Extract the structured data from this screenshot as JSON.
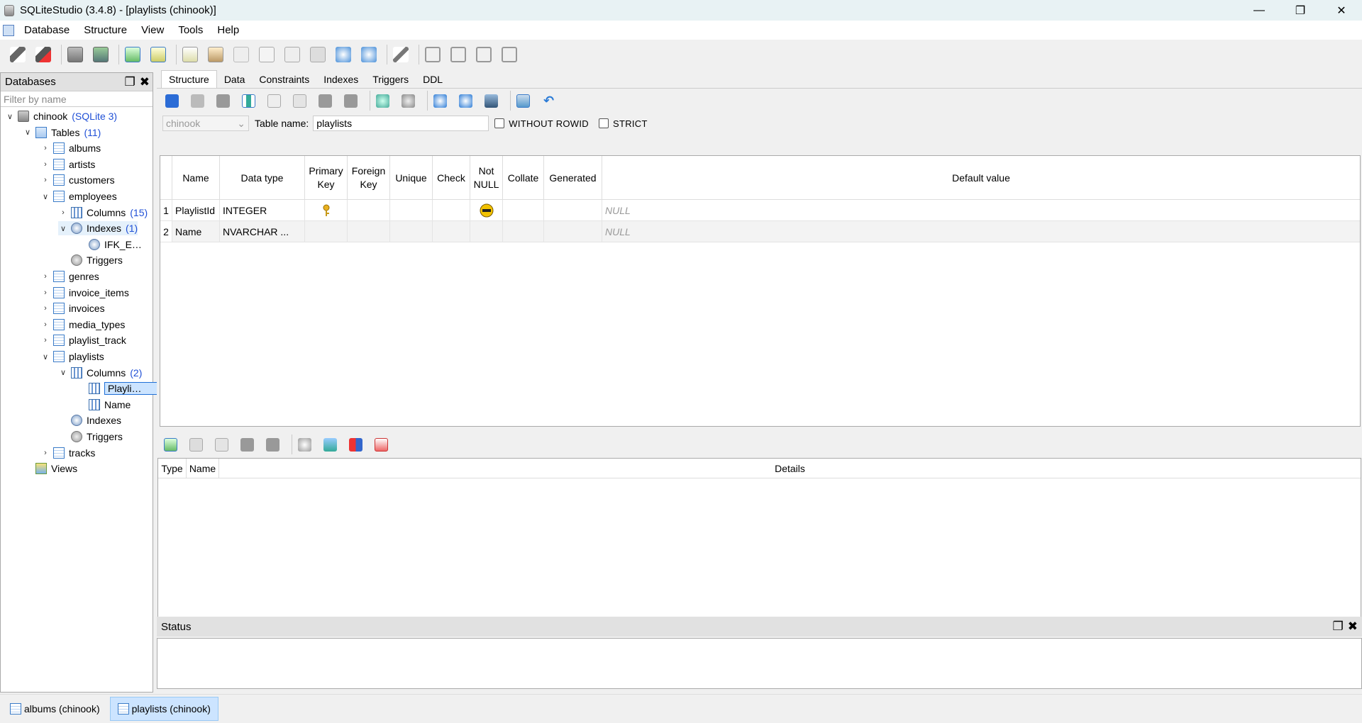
{
  "window": {
    "title": "SQLiteStudio (3.4.8) - [playlists (chinook)]"
  },
  "menu": [
    "Database",
    "Structure",
    "View",
    "Tools",
    "Help"
  ],
  "db_panel": {
    "title": "Databases",
    "filter_placeholder": "Filter by name",
    "tree": [
      {
        "label": "chinook",
        "extra": "(SQLite 3)",
        "level": 0,
        "icon": "database-icon",
        "chev": "v"
      },
      {
        "label": "Tables",
        "extra": "(11)",
        "level": 1,
        "icon": "tables-folder-icon",
        "chev": "v"
      },
      {
        "label": "albums",
        "level": 2,
        "icon": "table-icon",
        "chev": ">"
      },
      {
        "label": "artists",
        "level": 2,
        "icon": "table-icon",
        "chev": ">"
      },
      {
        "label": "customers",
        "level": 2,
        "icon": "table-icon",
        "chev": ">"
      },
      {
        "label": "employees",
        "level": 2,
        "icon": "table-icon",
        "chev": "v"
      },
      {
        "label": "Columns",
        "extra": "(15)",
        "level": 3,
        "icon": "columns-icon",
        "chev": ">"
      },
      {
        "label": "Indexes",
        "extra": "(1)",
        "level": 3,
        "icon": "index-icon",
        "chev": "v",
        "hover": true
      },
      {
        "label": "IFK_E…",
        "level": 4,
        "icon": "index-item-icon",
        "chev": ""
      },
      {
        "label": "Triggers",
        "level": 3,
        "icon": "trigger-icon",
        "chev": ""
      },
      {
        "label": "genres",
        "level": 2,
        "icon": "table-icon",
        "chev": ">"
      },
      {
        "label": "invoice_items",
        "level": 2,
        "icon": "table-icon",
        "chev": ">"
      },
      {
        "label": "invoices",
        "level": 2,
        "icon": "table-icon",
        "chev": ">"
      },
      {
        "label": "media_types",
        "level": 2,
        "icon": "table-icon",
        "chev": ">"
      },
      {
        "label": "playlist_track",
        "level": 2,
        "icon": "table-icon",
        "chev": ">"
      },
      {
        "label": "playlists",
        "level": 2,
        "icon": "table-icon",
        "chev": "v"
      },
      {
        "label": "Columns",
        "extra": "(2)",
        "level": 3,
        "icon": "columns-icon",
        "chev": "v"
      },
      {
        "label": "Playli…",
        "level": 4,
        "icon": "column-icon",
        "chev": "",
        "selected": true
      },
      {
        "label": "Name",
        "level": 4,
        "icon": "column-icon",
        "chev": ""
      },
      {
        "label": "Indexes",
        "level": 3,
        "icon": "index-icon",
        "chev": ""
      },
      {
        "label": "Triggers",
        "level": 3,
        "icon": "trigger-icon",
        "chev": ""
      },
      {
        "label": "tracks",
        "level": 2,
        "icon": "table-icon",
        "chev": ">"
      },
      {
        "label": "Views",
        "level": 1,
        "icon": "views-icon",
        "chev": ""
      }
    ]
  },
  "tabs": [
    "Structure",
    "Data",
    "Constraints",
    "Indexes",
    "Triggers",
    "DDL"
  ],
  "active_tab": "Structure",
  "structure": {
    "database_combo": "chinook",
    "table_name_label": "Table name:",
    "table_name": "playlists",
    "without_rowid_label": "WITHOUT ROWID",
    "strict_label": "STRICT",
    "columns_header": [
      "Name",
      "Data type",
      "Primary Key",
      "Foreign Key",
      "Unique",
      "Check",
      "Not NULL",
      "Collate",
      "Generated",
      "Default value"
    ],
    "rows": [
      {
        "num": "1",
        "name": "PlaylistId",
        "type": "INTEGER",
        "pk": true,
        "notnull": true,
        "default": "NULL"
      },
      {
        "num": "2",
        "name": "Name",
        "type": "NVARCHAR ...",
        "pk": false,
        "notnull": false,
        "default": "NULL"
      }
    ],
    "constraints_header": [
      "Type",
      "Name",
      "Details"
    ]
  },
  "status_panel": {
    "title": "Status"
  },
  "taskbar": [
    {
      "label": "albums (chinook)",
      "active": false
    },
    {
      "label": "playlists (chinook)",
      "active": true
    }
  ]
}
